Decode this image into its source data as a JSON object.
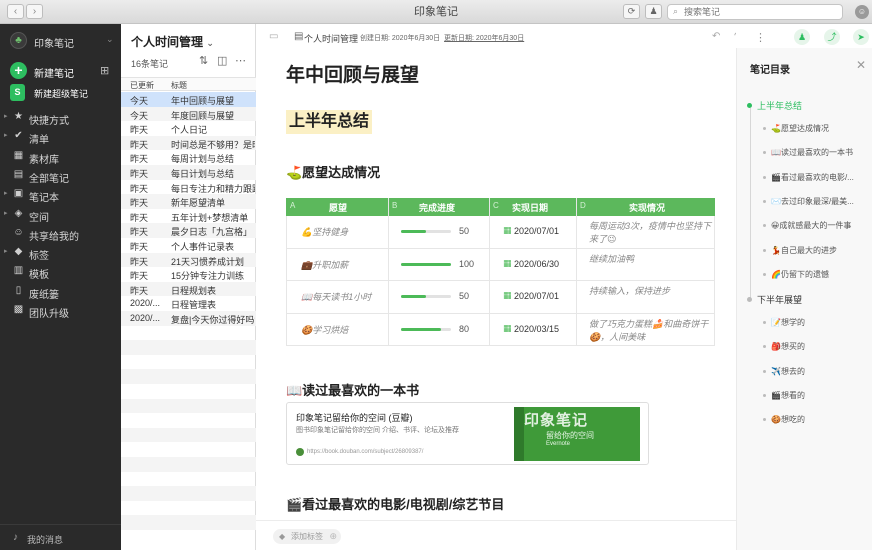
{
  "window": {
    "title": "印象笔记"
  },
  "search": {
    "placeholder": "搜索笔记"
  },
  "sidebar": {
    "account_name": "印象笔记",
    "new_note": "新建笔记",
    "new_super_note": "新建超级笔记",
    "items": [
      {
        "label": "快捷方式",
        "icon": "star-icon",
        "glyph": "★",
        "arrow": true
      },
      {
        "label": "清单",
        "icon": "checklist-icon",
        "glyph": "✔",
        "arrow": true
      },
      {
        "label": "素材库",
        "icon": "material-icon",
        "glyph": "▦",
        "arrow": false
      },
      {
        "label": "全部笔记",
        "icon": "notes-icon",
        "glyph": "▤",
        "arrow": false
      },
      {
        "label": "笔记本",
        "icon": "notebook-icon",
        "glyph": "▣",
        "arrow": true
      },
      {
        "label": "空间",
        "icon": "space-icon",
        "glyph": "◈",
        "arrow": true
      },
      {
        "label": "共享给我的",
        "icon": "shared-icon",
        "glyph": "☺",
        "arrow": false
      },
      {
        "label": "标签",
        "icon": "tag-icon",
        "glyph": "◆",
        "arrow": true
      },
      {
        "label": "模板",
        "icon": "template-icon",
        "glyph": "▥",
        "arrow": false
      },
      {
        "label": "废纸篓",
        "icon": "trash-icon",
        "glyph": "▯",
        "arrow": false
      },
      {
        "label": "团队升级",
        "icon": "team-icon",
        "glyph": "▩",
        "arrow": false
      }
    ],
    "footer": "我的消息"
  },
  "notelist": {
    "title": "个人时间管理",
    "count": "16条笔记",
    "col_updated": "已更新",
    "col_title": "标题",
    "rows": [
      {
        "date": "今天",
        "title": "年中回顾与展望"
      },
      {
        "date": "今天",
        "title": "年度回顾与展望"
      },
      {
        "date": "昨天",
        "title": "个人日记"
      },
      {
        "date": "昨天",
        "title": "时间总是不够用？是时候..."
      },
      {
        "date": "昨天",
        "title": "每周计划与总结"
      },
      {
        "date": "昨天",
        "title": "每日计划与总结"
      },
      {
        "date": "昨天",
        "title": "每日专注力和精力跟踪表"
      },
      {
        "date": "昨天",
        "title": "新年愿望清单"
      },
      {
        "date": "昨天",
        "title": "五年计划+梦想清单"
      },
      {
        "date": "昨天",
        "title": "晨夕日志「九宫格」"
      },
      {
        "date": "昨天",
        "title": "个人事件记录表"
      },
      {
        "date": "昨天",
        "title": "21天习惯养成计划"
      },
      {
        "date": "昨天",
        "title": "15分钟专注力训练"
      },
      {
        "date": "昨天",
        "title": "日程规划表"
      },
      {
        "date": "2020/...",
        "title": "日程管理表"
      },
      {
        "date": "2020/...",
        "title": "复盘|今天你过得好吗?"
      }
    ]
  },
  "editor": {
    "notebook": "个人时间管理",
    "created": "创建日期: 2020年6月30日",
    "updated": "更新日期: 2020年6月30日",
    "title": "年中回顾与展望",
    "section1": "上半年总结",
    "h_wishes": "⛳愿望达成情况",
    "table": {
      "col_letters": [
        "A",
        "B",
        "C",
        "D"
      ],
      "headers": [
        "愿望",
        "完成进度",
        "实现日期",
        "实现情况"
      ],
      "rows": [
        {
          "wish": "💪坚持健身",
          "progress": 50,
          "pct": "50",
          "date": "2020/07/01",
          "status": "每周运动3次，疫情中也坚持下来了😉"
        },
        {
          "wish": "💼升职加薪",
          "progress": 100,
          "pct": "100",
          "date": "2020/06/30",
          "status": "继续加油鸭"
        },
        {
          "wish": "📖每天读书1小时",
          "progress": 50,
          "pct": "50",
          "date": "2020/07/01",
          "status": "持续输入，保持进步"
        },
        {
          "wish": "🍪学习烘焙",
          "progress": 80,
          "pct": "80",
          "date": "2020/03/15",
          "status": "做了巧克力蛋糕🍰和曲奇饼干🍪，人间美味"
        }
      ]
    },
    "h_book": "📖读过最喜欢的一本书",
    "book": {
      "title": "印象笔记留给你的空间 (豆瓣)",
      "desc": "图书印象笔记留给你的空间 介绍、书评、论坛及推荐",
      "url": "https://book.douban.com/subject/26809387/",
      "cover_title": "印象笔记",
      "cover_sub": "留给你的空间",
      "cover_en": "Evernote"
    },
    "h_movie": "🎬看过最喜欢的电影/电视剧/综艺节目",
    "tag_placeholder": "添加标签"
  },
  "toc": {
    "title": "笔记目录",
    "h1a": "上半年总结",
    "items_a": [
      "⛳愿望达成情况",
      "📖读过最喜欢的一本书",
      "🎬看过最喜欢的电影/...",
      "✉️去过印象最深/最美...",
      "😀成就感最大的一件事",
      "💃自己最大的进步",
      "🌈仍留下的遗憾"
    ],
    "h1b": "下半年展望",
    "items_b": [
      "📝想学的",
      "🎒想买的",
      "✈️想去的",
      "🎬想看的",
      "🍪想吃的"
    ]
  },
  "colors": {
    "accent": "#2dbe60",
    "table_header": "#5cb85c",
    "highlight": "#fbf0c5",
    "sidebar": "#2a2a2a"
  }
}
